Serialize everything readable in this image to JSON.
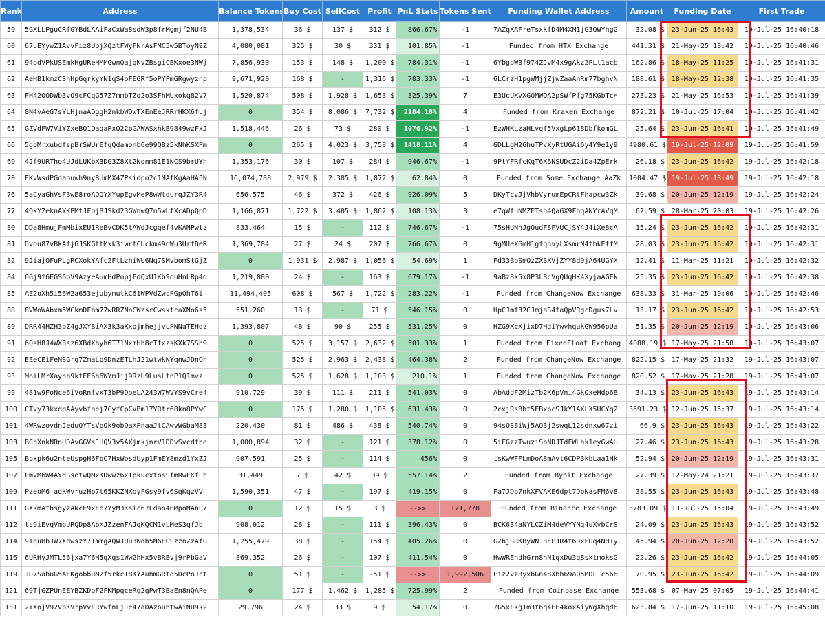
{
  "columns": [
    "Rank",
    "Address",
    "Balance Tokens",
    "Buy Cost",
    "SellCost",
    "Profit",
    "PnL Stats",
    "Tokens Sent",
    "Funding Wallet Address",
    "Amount",
    "Funding Date",
    "First Trade"
  ],
  "rows": [
    {
      "rank": "59",
      "address": "5GXLLPguCRfGYBdLAAiFaCxWa8sdW3p8frMgmjf2NU4B",
      "balance": "1,378,534",
      "buy": "36 $",
      "sell": "137 $",
      "profit": "312 $",
      "pnl": "866.67%",
      "sent": "-1",
      "funding": "7AZqXAFreTsxkfD4M4XM1jG3QWYngG",
      "amount": "32.08 $",
      "fdate": "23-Jun-25 16:43",
      "first": "19-Jul-25 16:40:18",
      "bal_hl": false,
      "sell_hl": false,
      "pnl_style": "mid",
      "sent_hl": false,
      "fdate_style": "yellow"
    },
    {
      "rank": "60",
      "address": "67uEYywZ1AvvFiz8UojXQztFWyFNrAsFMC5w5BToyN9Z",
      "balance": "4,080,081",
      "buy": "325 $",
      "sell": "30 $",
      "profit": "331 $",
      "pnl": "101.85%",
      "sent": "-1",
      "funding": "Funded from HTX Exchange",
      "amount": "441.31 $",
      "fdate": "21-May-25 18:42",
      "first": "19-Jul-25 16:40:46",
      "bal_hl": false,
      "sell_hl": false,
      "pnl_style": "light",
      "sent_hl": false,
      "fdate_style": "none"
    },
    {
      "rank": "61",
      "address": "94odVPkUSEmkHgUReHMMGwnQajqKvZBsgiCBKxoe3NWj",
      "balance": "7,856,930",
      "buy": "153 $",
      "sell": "148 $",
      "profit": "1,200 $",
      "pnl": "784.31%",
      "sent": "-1",
      "funding": "6YbgpW8f974ZJvM4x9gAkz2PLt1acb",
      "amount": "162.86 $",
      "fdate": "18-May-25 11:25",
      "first": "19-Jul-25 16:41:31",
      "bal_hl": false,
      "sell_hl": false,
      "pnl_style": "mid",
      "sent_hl": false,
      "fdate_style": "yellow"
    },
    {
      "rank": "62",
      "address": "AeHB1kmzCShHpGqrkyYN1qS4oFEGRf5oPYPmGRgwyznp",
      "balance": "9,671,920",
      "buy": "168 $",
      "sell": "-",
      "profit": "1,316 $",
      "pnl": "783.33%",
      "sent": "-1",
      "funding": "6LCrzH1pgWMjjZjwZaaAnRm77bghvN",
      "amount": "188.61 $",
      "fdate": "18-May-25 12:38",
      "first": "19-Jul-25 16:41:35",
      "bal_hl": false,
      "sell_hl": true,
      "pnl_style": "mid",
      "sent_hl": false,
      "fdate_style": "yellow"
    },
    {
      "rank": "63",
      "address": "FH42QQDWb3vQ9cFCqG57Z7mmbTZq2o3SFhMUxokq82V7",
      "balance": "1,520,874",
      "buy": "508 $",
      "sell": "1,928 $",
      "profit": "1,653 $",
      "pnl": "325.39%",
      "sent": "7",
      "funding": "E3UcUKVXGQMWQA2pSWfPfg75KGbTcH",
      "amount": "273.23 $",
      "fdate": "21-May-25 16:53",
      "first": "19-Jul-25 16:41:39",
      "bal_hl": false,
      "sell_hl": false,
      "pnl_style": "mid",
      "sent_hl": false,
      "fdate_style": "none"
    },
    {
      "rank": "64",
      "address": "8N4vAeG7sYLHjnaADggH2nkbWDwTXEnEeJRRrHKX6fuj",
      "balance": "0",
      "buy": "354 $",
      "sell": "8,086 $",
      "profit": "7,732 $",
      "pnl": "2184.18%",
      "sent": "4",
      "funding": "Funded from Kraken Exchange",
      "amount": "872.21 $",
      "fdate": "10-Jul-25 17:04",
      "first": "19-Jul-25 16:41:42",
      "bal_hl": true,
      "sell_hl": false,
      "pnl_style": "dark",
      "sent_hl": false,
      "fdate_style": "none"
    },
    {
      "rank": "65",
      "address": "GZVdFW7ViYZxeBQ1QaqaPxQ22pGAWASxhkB9849wzFxJ",
      "balance": "1,518,446",
      "buy": "26 $",
      "sell": "73 $",
      "profit": "280 $",
      "pnl": "1076.92%",
      "sent": "-1",
      "funding": "EzWHKLzaHLvqf5VxgLp618DbfkomGL",
      "amount": "25.64 $",
      "fdate": "23-Jun-25 16:41",
      "first": "19-Jul-25 16:41:49",
      "bal_hl": false,
      "sell_hl": false,
      "pnl_style": "dark",
      "sent_hl": false,
      "fdate_style": "yellow"
    },
    {
      "rank": "66",
      "address": "5gpMrxubdfspBrSWUrEfqQdamonb6e99QBz5kNhKSXPm",
      "balance": "0",
      "buy": "265 $",
      "sell": "4,023 $",
      "profit": "3,758 $",
      "pnl": "1418.11%",
      "sent": "4",
      "funding": "GDLLgM26huTPvXyRtUGAi6y4Y9e1y9",
      "amount": "4980.61 $",
      "fdate": "19-Jul-25 12:09",
      "first": "19-Jul-25 16:41:59",
      "bal_hl": true,
      "sell_hl": false,
      "pnl_style": "dark",
      "sent_hl": false,
      "fdate_style": "red"
    },
    {
      "rank": "69",
      "address": "4Jf9URTho4UJdLUKbX3DG3Z8Xt2Nonm81E1NCS9brUYh",
      "balance": "1,353,176",
      "buy": "30 $",
      "sell": "107 $",
      "profit": "284 $",
      "pnl": "946.67%",
      "sent": "-1",
      "funding": "9PtYFRfcKqT6X6NSUDcZ2iDa4ZpErk",
      "amount": "26.18 $",
      "fdate": "23-Jun-25 16:42",
      "first": "19-Jul-25 16:42:18",
      "bal_hl": false,
      "sell_hl": false,
      "pnl_style": "mid",
      "sent_hl": false,
      "fdate_style": "yellow"
    },
    {
      "rank": "70",
      "address": "FKvWsdPGdaouwh9ny8UmMX4ZPsidpo2c1MAfKgAaHA5N",
      "balance": "16,074,788",
      "buy": "2,979 $",
      "sell": "2,385 $",
      "profit": "1,872 $",
      "pnl": "62.84%",
      "sent": "0",
      "funding": "Funded from Some Exchange AaZk",
      "amount": "1004.47 $",
      "fdate": "19-Jul-25 13:49",
      "first": "19-Jul-25 16:42:18",
      "bal_hl": false,
      "sell_hl": false,
      "pnl_style": "light",
      "sent_hl": false,
      "fdate_style": "red"
    },
    {
      "rank": "76",
      "address": "5aCyaGhVsFBwE8roAQQYXYupEgvMeP8wWtdurqJZY3R4",
      "balance": "656,575",
      "buy": "46 $",
      "sell": "372 $",
      "profit": "426 $",
      "pnl": "926.09%",
      "sent": "5",
      "funding": "DKyTcvJjVhbVyrumEpCRtFhapcw3Zk",
      "amount": "39.68 $",
      "fdate": "20-Jun-25 12:19",
      "first": "19-Jul-25 16:42:24",
      "bal_hl": false,
      "sell_hl": false,
      "pnl_style": "mid",
      "sent_hl": false,
      "fdate_style": "pink"
    },
    {
      "rank": "77",
      "address": "4QkYZeknAYKPMtJFojBJSkd23GWnwQ7n5wUfXcADpQpD",
      "balance": "1,166,871",
      "buy": "1,722 $",
      "sell": "3,405 $",
      "profit": "1,862 $",
      "pnl": "108.13%",
      "sent": "3",
      "funding": "e7qWfuNMZETsh4QaGX9FhqANYrAVqM",
      "amount": "62.59 $",
      "fdate": "28-Mar-25 20:03",
      "first": "19-Jul-25 16:42:26",
      "bal_hl": false,
      "sell_hl": false,
      "pnl_style": "light",
      "sent_hl": false,
      "fdate_style": "none"
    },
    {
      "rank": "80",
      "address": "DDa8HmujFmMbixEU1ReBvCDK5tAWdJcgqef4vKANPwtz",
      "balance": "833,464",
      "buy": "15 $",
      "sell": "-",
      "profit": "112 $",
      "pnl": "746.67%",
      "sent": "-1",
      "funding": "75sHUNhJgQudF8FVUCjSY4J4iXe8cA",
      "amount": "15.24 $",
      "fdate": "23-Jun-25 16:42",
      "first": "19-Jul-25 16:42:31",
      "bal_hl": false,
      "sell_hl": true,
      "pnl_style": "mid",
      "sent_hl": false,
      "fdate_style": "yellow"
    },
    {
      "rank": "81",
      "address": "Dvou87vBkAfj6JSKGttMxk3iwrtCUckm49oWu3UrfDeR",
      "balance": "1,369,784",
      "buy": "27 $",
      "sell": "24 $",
      "profit": "207 $",
      "pnl": "766.67%",
      "sent": "0",
      "funding": "9gMUeXGmH1gfqnvyLXsmrN4tbkEffM",
      "amount": "28.03 $",
      "fdate": "23-Jun-25 16:42",
      "first": "19-Jul-25 16:42:31",
      "bal_hl": false,
      "sell_hl": false,
      "pnl_style": "mid",
      "sent_hl": false,
      "fdate_style": "yellow"
    },
    {
      "rank": "82",
      "address": "9JiajQFuPLgRCXokYAfc2FtLzhiWU6Nq7SMvbomStGjZ",
      "balance": "0",
      "buy": "1,931 $",
      "sell": "2,987 $",
      "profit": "1,056 $",
      "pnl": "54.69%",
      "sent": "1",
      "funding": "Fd33BbSmQzZXSXVjZYY8d9jA64UGYX",
      "amount": "12.41 $",
      "fdate": "11-Mar-25 11:21",
      "first": "19-Jul-25 16:42:32",
      "bal_hl": true,
      "sell_hl": false,
      "pnl_style": "light",
      "sent_hl": false,
      "fdate_style": "none"
    },
    {
      "rank": "84",
      "address": "6Gj9f6EGS6pV9AzyeAumHdPopjFdQxU1Kb9ouHnLRp4d",
      "balance": "1,219,880",
      "buy": "24 $",
      "sell": "-",
      "profit": "163 $",
      "pnl": "679.17%",
      "sent": "-1",
      "funding": "9aBz8k5x8P3L8cVgQUqHK4XyjaAGEk",
      "amount": "25.35 $",
      "fdate": "23-Jun-25 16:42",
      "first": "19-Jul-25 16:42:38",
      "bal_hl": false,
      "sell_hl": true,
      "pnl_style": "mid",
      "sent_hl": false,
      "fdate_style": "yellow"
    },
    {
      "rank": "85",
      "address": "AE2oXh5i56W2a653ejubymutkC61WPVdZwcPGpQhT6i",
      "balance": "11,494,405",
      "buy": "608 $",
      "sell": "567 $",
      "profit": "1,722 $",
      "pnl": "283.22%",
      "sent": "-1",
      "funding": "Funded from ChangeNow Exchange",
      "amount": "638.33 $",
      "fdate": "31-Mar-25 19:06",
      "first": "19-Jul-25 16:42:46",
      "bal_hl": false,
      "sell_hl": false,
      "pnl_style": "mid",
      "sent_hl": false,
      "fdate_style": "none"
    },
    {
      "rank": "88",
      "address": "8VWoWAbxm5WCkmDFbm77wRRZNnCWzsrCwsxtcaXNo6s5",
      "balance": "551,260",
      "buy": "13 $",
      "sell": "-",
      "profit": "71 $",
      "pnl": "546.15%",
      "sent": "0",
      "funding": "HpCJmf32CJmjaS4faQpVRgcDgus7Lv",
      "amount": "13.17 $",
      "fdate": "23-Jun-25 16:42",
      "first": "19-Jul-25 16:42:53",
      "bal_hl": false,
      "sell_hl": true,
      "pnl_style": "mid",
      "sent_hl": false,
      "fdate_style": "yellow"
    },
    {
      "rank": "89",
      "address": "DRR44HZH3pZ4gJXY8iAX3k3aKxqjmhejjvLPNNaTEHdz",
      "balance": "1,393,807",
      "buy": "48 $",
      "sell": "90 $",
      "profit": "255 $",
      "pnl": "531.25%",
      "sent": "0",
      "funding": "HZG9XcXjixD7HdiYwvhqukGW956pUa",
      "amount": "51.35 $",
      "fdate": "20-Jun-25 12:19",
      "first": "19-Jul-25 16:43:06",
      "bal_hl": false,
      "sell_hl": false,
      "pnl_style": "mid",
      "sent_hl": false,
      "fdate_style": "pink"
    },
    {
      "rank": "91",
      "address": "6QsH8J4WX8sz6XBdXhyh6T71NxmHh8cTfxzsKXk7SSh9",
      "balance": "0",
      "buy": "525 $",
      "sell": "3,157 $",
      "profit": "2,632 $",
      "pnl": "501.33%",
      "sent": "1",
      "funding": "Funded from FixedFloat Exchang",
      "amount": "4088.19 $",
      "fdate": "17-May-25 21:58",
      "first": "19-Jul-25 16:43:07",
      "bal_hl": true,
      "sell_hl": false,
      "pnl_style": "mid",
      "sent_hl": false,
      "fdate_style": "none"
    },
    {
      "rank": "92",
      "address": "EEeCEiFeNSGrq7ZmaLp9DnzETLhJ21wtwkNYqnwJDnQh",
      "balance": "0",
      "buy": "525 $",
      "sell": "2,963 $",
      "profit": "2,438 $",
      "pnl": "464.38%",
      "sent": "2",
      "funding": "Funded from ChangeNow Exchange",
      "amount": "822.15 $",
      "fdate": "17-May-25 21:32",
      "first": "19-Jul-25 16:43:07",
      "bal_hl": true,
      "sell_hl": false,
      "pnl_style": "mid",
      "sent_hl": false,
      "fdate_style": "none"
    },
    {
      "rank": "93",
      "address": "MoiLMrXayhp9ktEE6h6WYmJij9RzU9LusLtnP1Q1mvz",
      "balance": "0",
      "buy": "525 $",
      "sell": "1,628 $",
      "profit": "1,103 $",
      "pnl": "210.1%",
      "sent": "1",
      "funding": "Funded from ChangeNow Exchange",
      "amount": "820.52 $",
      "fdate": "17-May-25 21:28",
      "first": "19-Jul-25 16:43:07",
      "bal_hl": true,
      "sell_hl": false,
      "pnl_style": "light",
      "sent_hl": false,
      "fdate_style": "none"
    },
    {
      "rank": "99",
      "address": "481w9FoNce6iVoRnfvxT3bP9DoeLA243W7WVYS9vCre4",
      "balance": "910,729",
      "buy": "39 $",
      "sell": "111 $",
      "profit": "211 $",
      "pnl": "541.03%",
      "sent": "0",
      "funding": "AbAddF2MizTb2K6pVni4GkQxeHdp6B",
      "amount": "34.13 $",
      "fdate": "23-Jun-25 16:43",
      "first": "19-Jul-25 16:43:14",
      "bal_hl": false,
      "sell_hl": false,
      "pnl_style": "mid",
      "sent_hl": false,
      "fdate_style": "yellow"
    },
    {
      "rank": "100",
      "address": "CTvy73kxdpAAyvbfaej7CyfCpCVBm17YRtr68kn8PYwC",
      "balance": "0",
      "buy": "175 $",
      "sell": "1,280 $",
      "profit": "1,105 $",
      "pnl": "631.43%",
      "sent": "0",
      "funding": "2cxjRs8bt5EBxbcSJkY1AXLX5UCYq2",
      "amount": "3691.23 $",
      "fdate": "12-Jun-25 15:37",
      "first": "19-Jul-25 16:43:14",
      "bal_hl": true,
      "sell_hl": false,
      "pnl_style": "mid",
      "sent_hl": false,
      "fdate_style": "none"
    },
    {
      "rank": "101",
      "address": "4WRwzovdnJeduQYTsVpQk9obQaXPnaaJtCAwvWGbaM83",
      "balance": "220,430",
      "buy": "81 $",
      "sell": "486 $",
      "profit": "438 $",
      "pnl": "540.74%",
      "sent": "0",
      "funding": "94sQS8iWj5AQ3j2swqL12sdnxw67zi",
      "amount": "66.9 $",
      "fdate": "23-Jun-25 16:43",
      "first": "19-Jul-25 16:43:22",
      "bal_hl": false,
      "sell_hl": false,
      "pnl_style": "mid",
      "sent_hl": false,
      "fdate_style": "yellow"
    },
    {
      "rank": "103",
      "address": "BCbXnkNRnUDAvGGVsJUQV3v5AXjmkjnrV1DDvSvcdfne",
      "balance": "1,000,894",
      "buy": "32 $",
      "sell": "-",
      "profit": "121 $",
      "pnl": "378.12%",
      "sent": "0",
      "funding": "5iFGzzTwuziSbNDJTdFWLhk1eyGwAU",
      "amount": "27.46 $",
      "fdate": "23-Jun-25 16:43",
      "first": "19-Jul-25 16:43:28",
      "bal_hl": false,
      "sell_hl": true,
      "pnl_style": "mid",
      "sent_hl": false,
      "fdate_style": "yellow"
    },
    {
      "rank": "105",
      "address": "Bpxpk6u2nteUspgH6FbC7HxWosdUyp1FmEY8mzd1YxZJ",
      "balance": "907,591",
      "buy": "25 $",
      "sell": "-",
      "profit": "114 $",
      "pnl": "456%",
      "sent": "0",
      "funding": "tsKwWFFLmDoA8mAvt6CDP3kbLaa1Hk",
      "amount": "52.94 $",
      "fdate": "20-Jun-25 12:19",
      "first": "19-Jul-25 16:43:31",
      "bal_hl": false,
      "sell_hl": true,
      "pnl_style": "mid",
      "sent_hl": false,
      "fdate_style": "pink"
    },
    {
      "rank": "107",
      "address": "FmVM6W4AYdSsetwQMxKDwwz6xTpkucxtosSfmRwFKfLh",
      "balance": "31,449",
      "buy": "7 $",
      "sell": "42 $",
      "profit": "39 $",
      "pnl": "557.14%",
      "sent": "2",
      "funding": "Funded from Bybit Exchange",
      "amount": "27.39 $",
      "fdate": "12-May-24 21:21",
      "first": "19-Jul-25 16:43:37",
      "bal_hl": false,
      "sell_hl": false,
      "pnl_style": "mid",
      "sent_hl": false,
      "fdate_style": "none"
    },
    {
      "rank": "109",
      "address": "PzeoM6jadkWvruzHp7t65KKZNXoyFGsy9fv6SgKqzVV",
      "balance": "1,590,351",
      "buy": "47 $",
      "sell": "-",
      "profit": "197 $",
      "pnl": "419.15%",
      "sent": "0",
      "funding": "Fa7JDb7nkXFVAKE6dpt7DpNasFM6v8",
      "amount": "38.55 $",
      "fdate": "23-Jun-25 16:43",
      "first": "19-Jul-25 16:43:48",
      "bal_hl": false,
      "sell_hl": true,
      "pnl_style": "mid",
      "sent_hl": false,
      "fdate_style": "yellow"
    },
    {
      "rank": "111",
      "address": "GXkmAthsgyzANcE9xEe7YyM3Ksic67Ldao4BMpoNAnu7",
      "balance": "0",
      "buy": "12 $",
      "sell": "15 $",
      "profit": "3 $",
      "pnl": "-->>",
      "sent": "171,778",
      "funding": "Funded from Binance Exchange",
      "amount": "3783.09 $",
      "fdate": "13-Jul-25 15:04",
      "first": "19-Jul-25 16:43:49",
      "bal_hl": true,
      "sell_hl": false,
      "pnl_style": "neg",
      "sent_hl": true,
      "fdate_style": "none"
    },
    {
      "rank": "112",
      "address": "ts9iEvqVmpURQDp8AbXJZzenFAJgKQCM1vLMeS3qfJb",
      "balance": "908,012",
      "buy": "28 $",
      "sell": "-",
      "profit": "111 $",
      "pnl": "396.43%",
      "sent": "0",
      "funding": "BCK634aNYLCZiM4deVYYNg4uXvbCrS",
      "amount": "24.09 $",
      "fdate": "23-Jun-25 16:43",
      "first": "19-Jul-25 16:43:52",
      "bal_hl": false,
      "sell_hl": true,
      "pnl_style": "mid",
      "sent_hl": false,
      "fdate_style": "yellow"
    },
    {
      "rank": "114",
      "address": "9TquHbJW7XdwszY7TmmgAQWJUu3Wdb5N6EUSzznZzAfG",
      "balance": "1,255,479",
      "buy": "38 $",
      "sell": "-",
      "profit": "154 $",
      "pnl": "405.26%",
      "sent": "0",
      "funding": "GZbjSRKByWNJ3EPJR4t6DxEUq4NH1y",
      "amount": "45.94 $",
      "fdate": "20-Jun-25 12:20",
      "first": "19-Jul-25 16:43:52",
      "bal_hl": false,
      "sell_hl": true,
      "pnl_style": "mid",
      "sent_hl": false,
      "fdate_style": "pink"
    },
    {
      "rank": "116",
      "address": "6URHyJMTL56jxa7Y6H5gXqs1Ww2hHx5vBRBvj9rPbGaV",
      "balance": "869,352",
      "buy": "26 $",
      "sell": "-",
      "profit": "107 $",
      "pnl": "411.54%",
      "sent": "0",
      "funding": "HwWREndhGrn8nN1gxDu3g8sktmoksG",
      "amount": "22.26 $",
      "fdate": "23-Jun-25 16:42",
      "first": "19-Jul-25 16:44:05",
      "bal_hl": false,
      "sell_hl": true,
      "pnl_style": "mid",
      "sent_hl": false,
      "fdate_style": "yellow"
    },
    {
      "rank": "119",
      "address": "JD7SabuG5AFKgobbuM2f5rkcT8KYAuhmGRtq5DcPoJct",
      "balance": "0",
      "buy": "51 $",
      "sell": "-",
      "profit": "-51 $",
      "pnl": "-->>",
      "sent": "1,992,506",
      "funding": "Fiz2vz8yxbGn48Xbb69aQ5MDLTc566",
      "amount": "70.95 $",
      "fdate": "23-Jun-25 16:42",
      "first": "19-Jul-25 16:44:09",
      "bal_hl": true,
      "sell_hl": true,
      "pnl_style": "neg",
      "sent_hl": true,
      "fdate_style": "yellow"
    },
    {
      "rank": "121",
      "address": "69TjGZPUnEEYBZKDoF2FKMpgceRq2gPwT3BaEn8nQAPe",
      "balance": "0",
      "buy": "177 $",
      "sell": "1,462 $",
      "profit": "1,285 $",
      "pnl": "725.99%",
      "sent": "2",
      "funding": "Funded from Coinbase Exchange",
      "amount": "553.68 $",
      "fdate": "07-May-25 07:05",
      "first": "19-Jul-25 16:44:41",
      "bal_hl": true,
      "sell_hl": false,
      "pnl_style": "mid",
      "sent_hl": false,
      "fdate_style": "none"
    },
    {
      "rank": "131",
      "address": "2YXojV92VbKVrpVvLRYwfnLjJe47aDAzouhtwAiNU9k2",
      "balance": "29,796",
      "buy": "24 $",
      "sell": "33 $",
      "profit": "9 $",
      "pnl": "54.17%",
      "sent": "0",
      "funding": "7G5xFkg1m3t6q4EE4koxAiyWgXhqd6",
      "amount": "623.84 $",
      "fdate": "17-Jun-25 11:10",
      "first": "19-Jul-25 16:45:08",
      "bal_hl": false,
      "sell_hl": false,
      "pnl_style": "light",
      "sent_hl": false,
      "fdate_style": "none"
    }
  ],
  "highlights": [
    {
      "label": "group-1",
      "color": "#e0101e"
    },
    {
      "label": "group-2",
      "color": "#e0101e"
    },
    {
      "label": "group-3",
      "color": "#e0101e"
    }
  ]
}
